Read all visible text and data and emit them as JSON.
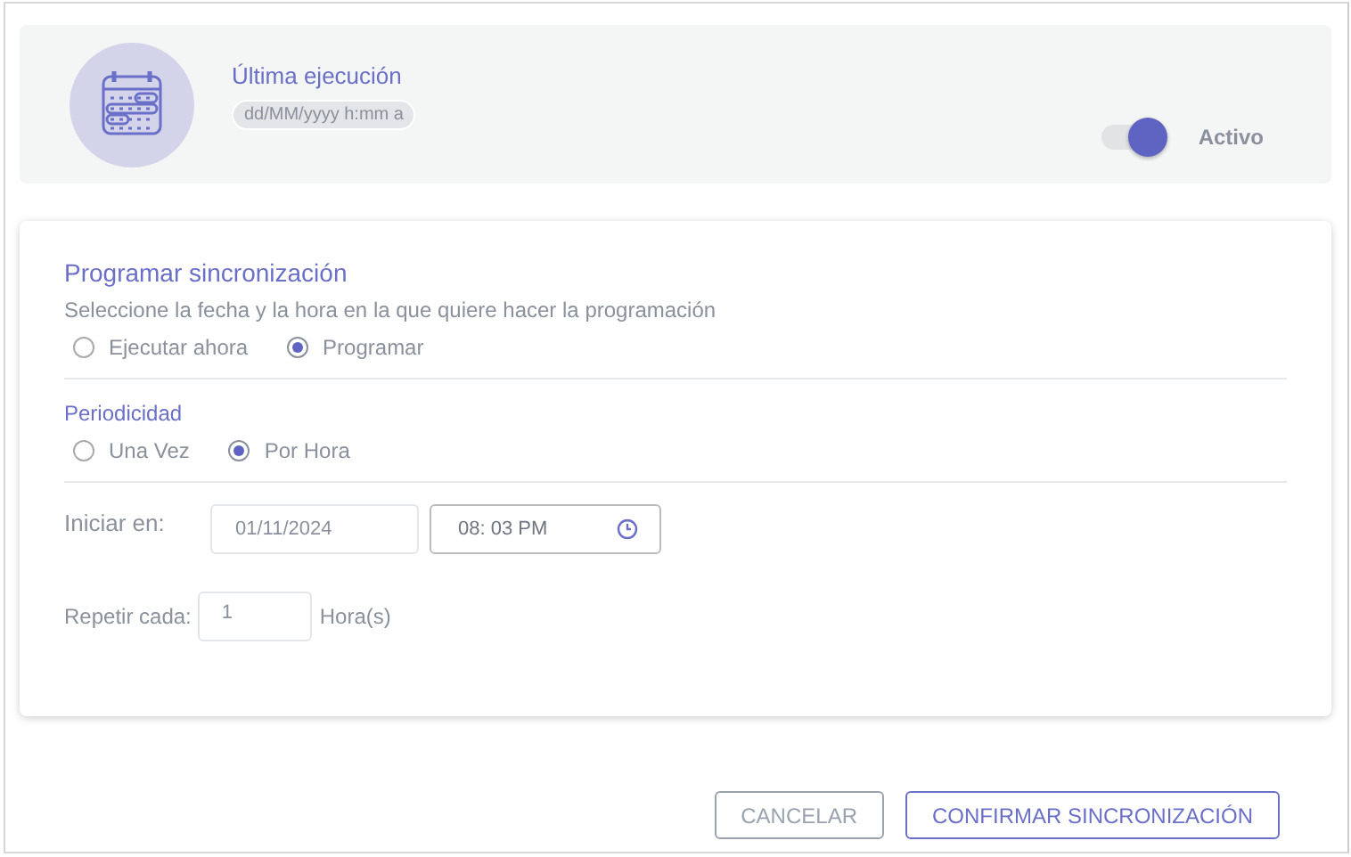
{
  "header": {
    "title": "Última ejecución",
    "last_run": "dd/MM/yyyy h:mm a",
    "toggle": {
      "label": "Activo",
      "on": true
    }
  },
  "schedule": {
    "title": "Programar sincronización",
    "subtitle": "Seleccione la fecha y la hora en la que quiere hacer la programación",
    "modes": [
      {
        "label": "Ejecutar ahora",
        "selected": false
      },
      {
        "label": "Programar",
        "selected": true
      }
    ],
    "periodicity": {
      "label": "Periodicidad",
      "options": [
        {
          "label": "Una Vez",
          "selected": false
        },
        {
          "label": "Por Hora",
          "selected": true
        }
      ]
    },
    "start": {
      "label": "Iniciar en:",
      "date": "01/11/2024",
      "time": "08: 03 PM"
    },
    "repeat": {
      "label": "Repetir cada:",
      "value": "1",
      "unit": "Hora(s)"
    }
  },
  "buttons": [
    {
      "label": "CANCELAR",
      "kind": "secondary"
    },
    {
      "label": "CONFIRMAR SINCRONIZACIÓN",
      "kind": "primary"
    }
  ]
}
